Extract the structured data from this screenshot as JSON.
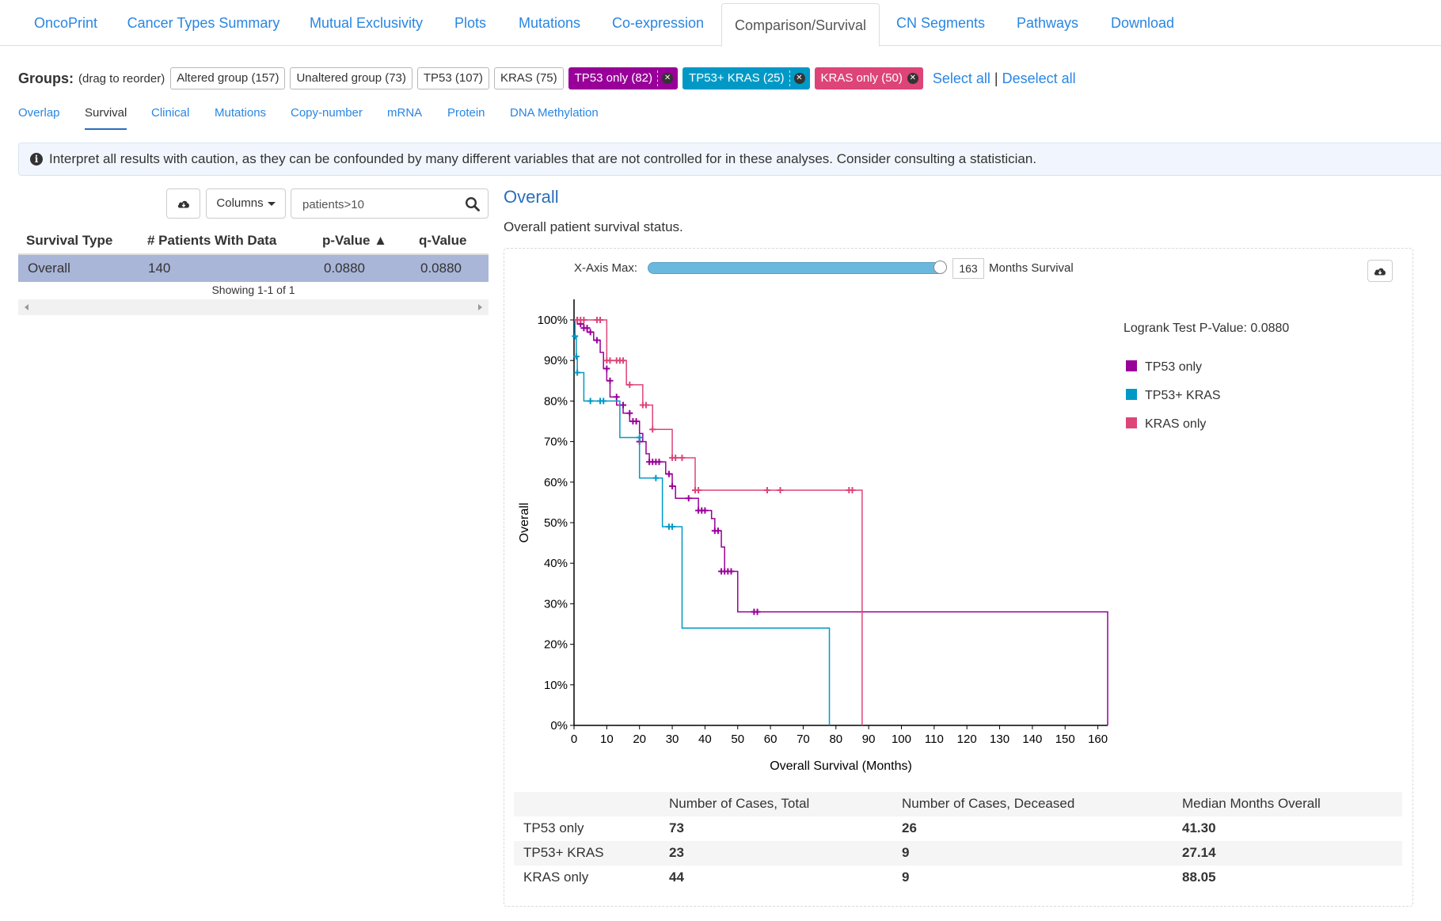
{
  "tabs": [
    "OncoPrint",
    "Cancer Types Summary",
    "Mutual Exclusivity",
    "Plots",
    "Mutations",
    "Co-expression",
    "Comparison/Survival",
    "CN Segments",
    "Pathways",
    "Download"
  ],
  "active_tab": "Comparison/Survival",
  "groups": {
    "label": "Groups:",
    "hint": "(drag to reorder)",
    "items": [
      {
        "label": "Altered group (157)",
        "selected": false
      },
      {
        "label": "Unaltered group (73)",
        "selected": false
      },
      {
        "label": "TP53 (107)",
        "selected": false
      },
      {
        "label": "KRAS (75)",
        "selected": false
      },
      {
        "label": "TP53 only (82)",
        "selected": true,
        "color": "#990099"
      },
      {
        "label": "TP53+ KRAS (25)",
        "selected": true,
        "color": "#0099c6"
      },
      {
        "label": "KRAS only (50)",
        "selected": true,
        "color": "#dd4477"
      }
    ],
    "select_all": "Select all",
    "deselect_all": "Deselect all"
  },
  "subtabs": [
    "Overlap",
    "Survival",
    "Clinical",
    "Mutations",
    "Copy-number",
    "mRNA",
    "Protein",
    "DNA Methylation"
  ],
  "active_subtab": "Survival",
  "info": "Interpret all results with caution, as they can be confounded by many different variables that are not controlled for in these analyses. Consider consulting a statistician.",
  "survival_table": {
    "columns_button": "Columns",
    "search_value": "patients>10",
    "headers": [
      "Survival Type",
      "# Patients With Data",
      "p-Value ▲",
      "q-Value"
    ],
    "rows": [
      [
        "Overall",
        "140",
        "0.0880",
        "0.0880"
      ]
    ],
    "showing": "Showing 1-1 of 1"
  },
  "panel": {
    "title": "Overall",
    "description": "Overall patient survival status.",
    "x_axis_max_label": "X-Axis Max:",
    "x_axis_max_value": "163",
    "x_axis_unit": "Months Survival",
    "slider_fraction": 1.0
  },
  "chart_data": {
    "type": "line",
    "subtype": "kaplan-meier step",
    "xlabel": "Overall Survival (Months)",
    "ylabel": "Overall",
    "xlim": [
      0,
      163
    ],
    "ylim": [
      0,
      100
    ],
    "x_ticks": [
      0,
      10,
      20,
      30,
      40,
      50,
      60,
      70,
      80,
      90,
      100,
      110,
      120,
      130,
      140,
      150,
      160
    ],
    "y_ticks": [
      "0%",
      "10%",
      "20%",
      "30%",
      "40%",
      "50%",
      "60%",
      "70%",
      "80%",
      "90%",
      "100%"
    ],
    "annotation": "Logrank Test P-Value: 0.0880",
    "legend_position": "top-right",
    "series": [
      {
        "name": "TP53 only",
        "color": "#990099",
        "steps": [
          [
            0,
            100
          ],
          [
            1,
            99
          ],
          [
            3,
            98
          ],
          [
            4,
            97
          ],
          [
            6,
            95
          ],
          [
            8,
            92
          ],
          [
            9,
            88
          ],
          [
            10,
            85
          ],
          [
            11,
            81
          ],
          [
            13,
            79
          ],
          [
            15,
            77
          ],
          [
            17,
            75
          ],
          [
            20,
            72
          ],
          [
            21,
            70
          ],
          [
            22,
            67
          ],
          [
            23,
            65
          ],
          [
            28,
            62
          ],
          [
            30,
            59
          ],
          [
            31,
            56
          ],
          [
            35,
            56
          ],
          [
            38,
            53
          ],
          [
            42,
            51
          ],
          [
            43,
            48
          ],
          [
            45,
            44
          ],
          [
            46,
            38
          ],
          [
            49,
            38
          ],
          [
            50,
            28
          ],
          [
            163,
            28
          ],
          [
            163,
            0
          ]
        ],
        "censored": [
          [
            1,
            100
          ],
          [
            2,
            99
          ],
          [
            3,
            98
          ],
          [
            4,
            98
          ],
          [
            5,
            97
          ],
          [
            7,
            95
          ],
          [
            10,
            88
          ],
          [
            11,
            85
          ],
          [
            13,
            81
          ],
          [
            15,
            79
          ],
          [
            17,
            77
          ],
          [
            18,
            75
          ],
          [
            19,
            75
          ],
          [
            20,
            70
          ],
          [
            23,
            65
          ],
          [
            24,
            65
          ],
          [
            25,
            65
          ],
          [
            26,
            65
          ],
          [
            29,
            62
          ],
          [
            30,
            59
          ],
          [
            35,
            56
          ],
          [
            38,
            53
          ],
          [
            39,
            53
          ],
          [
            40,
            53
          ],
          [
            43,
            48
          ],
          [
            44,
            48
          ],
          [
            45,
            38
          ],
          [
            46,
            38
          ],
          [
            47,
            38
          ],
          [
            48,
            38
          ],
          [
            55,
            28
          ],
          [
            56,
            28
          ]
        ]
      },
      {
        "name": "TP53+ KRAS",
        "color": "#0099c6",
        "steps": [
          [
            0,
            100
          ],
          [
            0.3,
            96
          ],
          [
            0.7,
            91
          ],
          [
            1,
            87
          ],
          [
            3,
            80
          ],
          [
            10,
            80
          ],
          [
            14,
            71
          ],
          [
            19,
            71
          ],
          [
            20,
            61
          ],
          [
            26,
            61
          ],
          [
            27,
            49
          ],
          [
            33,
            49
          ],
          [
            33,
            24
          ],
          [
            78,
            24
          ],
          [
            78,
            0
          ]
        ],
        "censored": [
          [
            0.3,
            96
          ],
          [
            0.7,
            91
          ],
          [
            1,
            87
          ],
          [
            5,
            80
          ],
          [
            8,
            80
          ],
          [
            9,
            80
          ],
          [
            20,
            71
          ],
          [
            25,
            61
          ],
          [
            29,
            49
          ],
          [
            30,
            49
          ]
        ]
      },
      {
        "name": "KRAS only",
        "color": "#dd4477",
        "steps": [
          [
            0,
            100
          ],
          [
            9,
            100
          ],
          [
            10,
            90
          ],
          [
            15,
            90
          ],
          [
            16,
            84
          ],
          [
            20,
            84
          ],
          [
            21,
            79
          ],
          [
            23,
            79
          ],
          [
            24,
            73
          ],
          [
            29,
            73
          ],
          [
            30,
            66
          ],
          [
            36,
            66
          ],
          [
            37,
            58
          ],
          [
            88,
            58
          ],
          [
            88,
            0
          ]
        ],
        "censored": [
          [
            1,
            100
          ],
          [
            2,
            100
          ],
          [
            3,
            100
          ],
          [
            7,
            100
          ],
          [
            8,
            100
          ],
          [
            10,
            90
          ],
          [
            11,
            90
          ],
          [
            13,
            90
          ],
          [
            14,
            90
          ],
          [
            15,
            90
          ],
          [
            17,
            84
          ],
          [
            21,
            79
          ],
          [
            22,
            79
          ],
          [
            24,
            73
          ],
          [
            30,
            66
          ],
          [
            31,
            66
          ],
          [
            33,
            66
          ],
          [
            37,
            58
          ],
          [
            38,
            58
          ],
          [
            59,
            58
          ],
          [
            63,
            58
          ],
          [
            84,
            58
          ],
          [
            85,
            58
          ]
        ]
      }
    ]
  },
  "summary": {
    "headers": [
      "",
      "Number of Cases, Total",
      "Number of Cases, Deceased",
      "Median Months Overall"
    ],
    "rows": [
      [
        "TP53 only",
        "73",
        "26",
        "41.30"
      ],
      [
        "TP53+ KRAS",
        "23",
        "9",
        "27.14"
      ],
      [
        "KRAS only",
        "44",
        "9",
        "88.05"
      ]
    ]
  }
}
